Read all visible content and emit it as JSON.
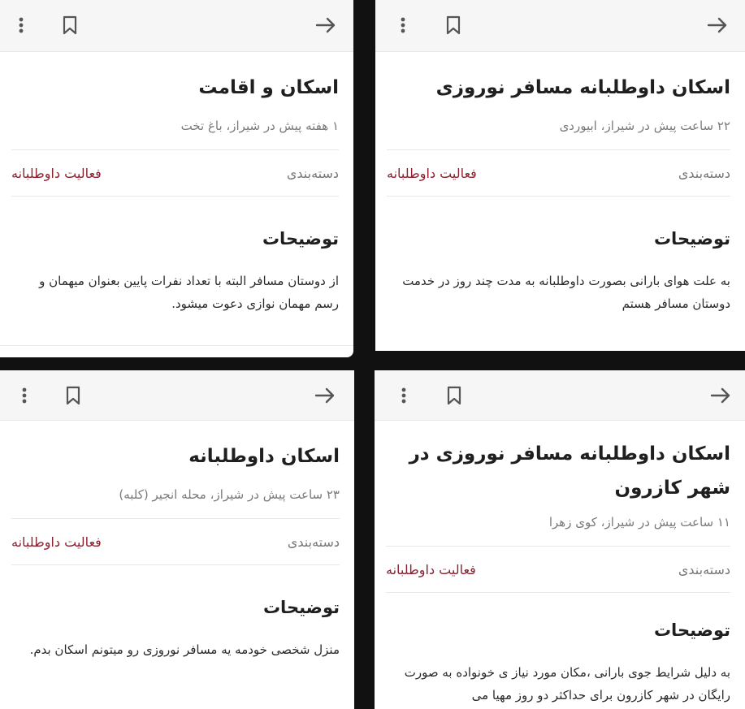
{
  "colors": {
    "accent": "#8c2230",
    "meta": "#7a7a7a",
    "title": "#1f1f1f",
    "topbar": "#f6f6f6",
    "background": "#111111"
  },
  "icons": {
    "more": "more-vertical-icon",
    "bookmark": "bookmark-icon",
    "back": "arrow-right-icon"
  },
  "cards": [
    {
      "title": "اسکان و اقامت",
      "meta": "۱ هفته پیش در شیراز، باغ تخت",
      "category_label": "دسته‌بندی",
      "category_value": "فعالیت داوطلبانه",
      "description_title": "توضیحات",
      "description": "از دوستان مسافر البته با تعداد نفرات پایین بعنوان میهمان و رسم مهمان نوازی دعوت میشود."
    },
    {
      "title": "اسکان داوطلبانه مسافر نوروزی",
      "meta": "۲۲ ساعت پیش در شیراز، ابیوردی",
      "category_label": "دسته‌بندی",
      "category_value": "فعالیت داوطلبانه",
      "description_title": "توضیحات",
      "description": "به علت هوای بارانی بصورت داوطلبانه به مدت چند روز در خدمت دوستان مسافر هستم"
    },
    {
      "title": "اسکان داوطلبانه",
      "meta": "۲۳ ساعت پیش در شیراز، محله انجیر (کلبه)",
      "category_label": "دسته‌بندی",
      "category_value": "فعالیت داوطلبانه",
      "description_title": "توضیحات",
      "description": "منزل شخصی خودمه یه مسافر نوروزی رو میتونم اسکان بدم."
    },
    {
      "title": "اسکان داوطلبانه مسافر نوروزی در شهر کازرون",
      "meta": "۱۱ ساعت پیش در شیراز، کوی زهرا",
      "category_label": "دسته‌بندی",
      "category_value": "فعالیت داوطلبانه",
      "description_title": "توضیحات",
      "description": "به دلیل شرایط جوی بارانی ،مکان مورد نیاز ی خونواده به صورت رایگان در شهر کازرون برای حداکثر دو روز مهیا می"
    }
  ]
}
